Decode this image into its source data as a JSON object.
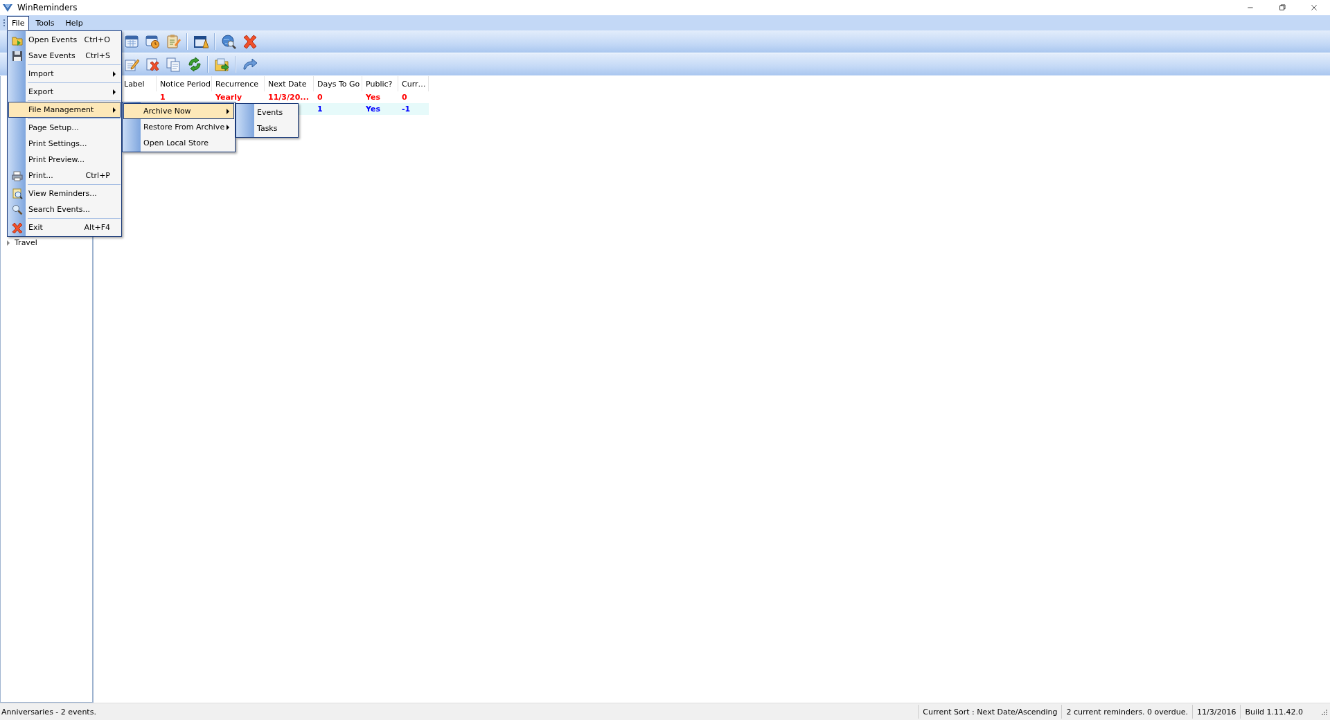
{
  "window": {
    "title": "WinReminders"
  },
  "menu_bar": [
    {
      "label": "File",
      "selected": true
    },
    {
      "label": "Tools",
      "selected": false
    },
    {
      "label": "Help",
      "selected": false
    }
  ],
  "file_menu": [
    {
      "kind": "item",
      "label": "Open Events",
      "shortcut": "Ctrl+O",
      "has_submenu": false,
      "selected": false
    },
    {
      "kind": "item",
      "label": "Save Events",
      "shortcut": "Ctrl+S",
      "has_submenu": false,
      "selected": false
    },
    {
      "kind": "separator"
    },
    {
      "kind": "item",
      "label": "Import",
      "has_submenu": true,
      "selected": false
    },
    {
      "kind": "separator"
    },
    {
      "kind": "item",
      "label": "Export",
      "has_submenu": true,
      "selected": false
    },
    {
      "kind": "separator"
    },
    {
      "kind": "item",
      "label": "File Management",
      "has_submenu": true,
      "selected": true
    },
    {
      "kind": "separator"
    },
    {
      "kind": "item",
      "label": "Page Setup...",
      "has_submenu": false,
      "selected": false
    },
    {
      "kind": "item",
      "label": "Print Settings...",
      "has_submenu": false,
      "selected": false
    },
    {
      "kind": "item",
      "label": "Print Preview...",
      "has_submenu": false,
      "selected": false
    },
    {
      "kind": "item",
      "label": "Print...",
      "shortcut": "Ctrl+P",
      "has_submenu": false,
      "selected": false
    },
    {
      "kind": "separator"
    },
    {
      "kind": "item",
      "label": "View Reminders...",
      "has_submenu": false,
      "selected": false
    },
    {
      "kind": "item",
      "label": "Search Events...",
      "has_submenu": false,
      "selected": false
    },
    {
      "kind": "separator"
    },
    {
      "kind": "item",
      "label": "Exit",
      "shortcut": "Alt+F4",
      "has_submenu": false,
      "selected": false
    }
  ],
  "file_management_menu": [
    {
      "kind": "item",
      "label": "Archive Now",
      "has_submenu": true,
      "selected": true
    },
    {
      "kind": "item",
      "label": "Restore From Archive",
      "has_submenu": true,
      "selected": false
    },
    {
      "kind": "item",
      "label": "Open Local Store",
      "has_submenu": false,
      "selected": false
    }
  ],
  "archive_now_menu": [
    {
      "kind": "item",
      "label": "Events",
      "has_submenu": false,
      "selected": false
    },
    {
      "kind": "item",
      "label": "Tasks",
      "has_submenu": false,
      "selected": false
    }
  ],
  "tree": {
    "items": [
      {
        "label": "Travel",
        "expanded": false
      }
    ]
  },
  "table": {
    "columns": [
      "Label",
      "Notice Period",
      "Recurrence",
      "Next Date",
      "Days To Go",
      "Public?",
      "Curr…"
    ],
    "rows": [
      {
        "color": "#ff0000",
        "selected": false,
        "cells": [
          null,
          "1",
          "Yearly",
          "11/3/20...",
          "0",
          "Yes",
          "0"
        ]
      },
      {
        "color": "#0000ff",
        "selected": true,
        "cells": [
          null,
          null,
          null,
          null,
          "1",
          "Yes",
          "-1"
        ]
      }
    ]
  },
  "status_bar": {
    "message": "Anniversaries - 2 events.",
    "sections": [
      "Current Sort : Next Date/Ascending",
      "2 current reminders. 0 overdue.",
      "11/3/2016",
      "Build 1.11.42.0"
    ]
  }
}
